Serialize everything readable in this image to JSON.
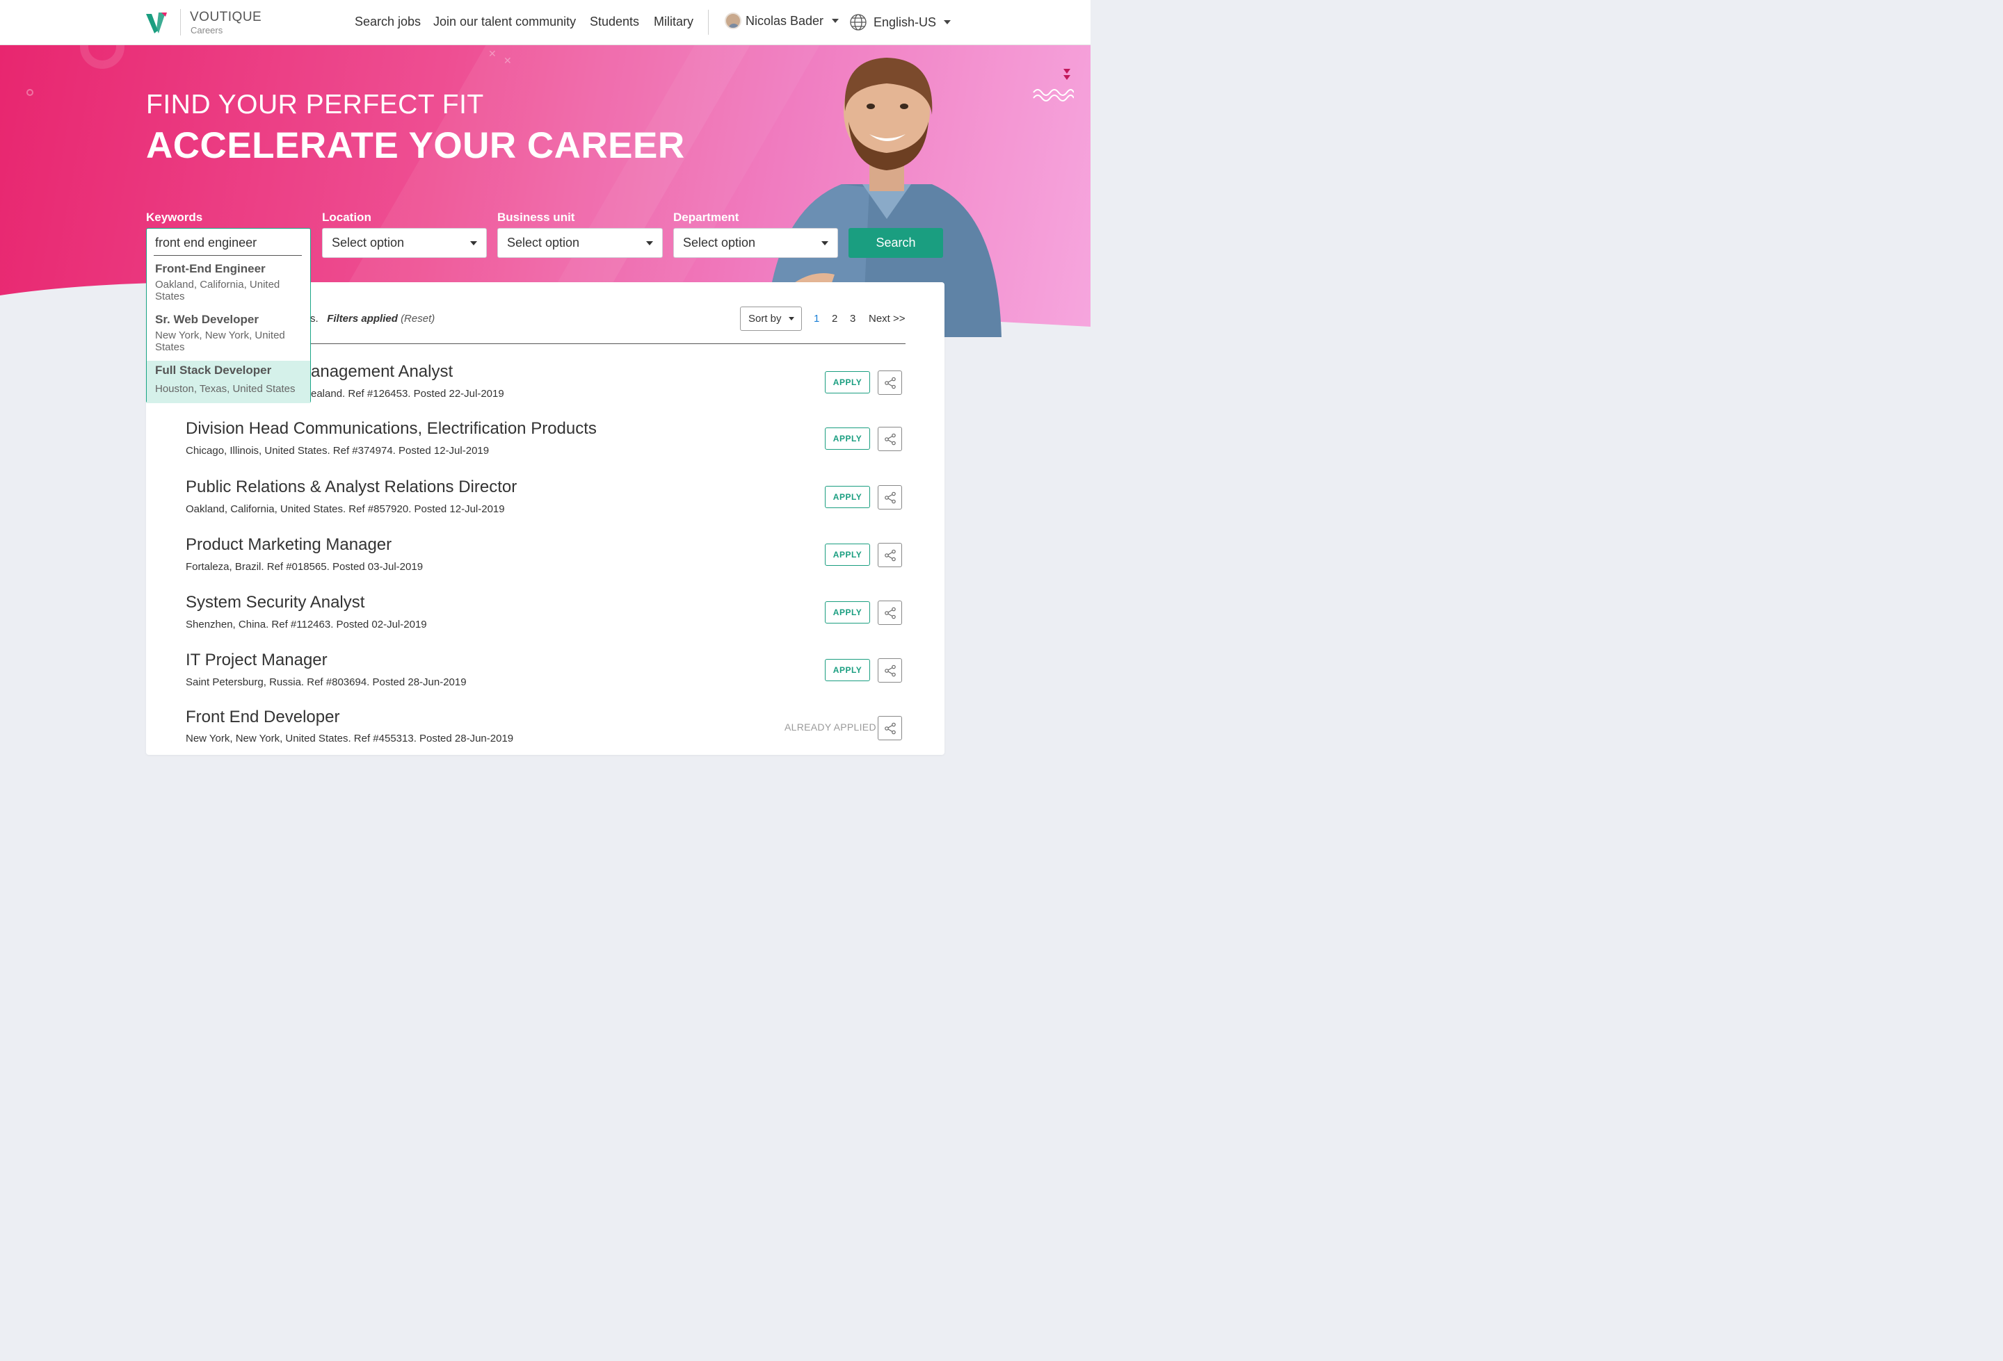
{
  "brand": {
    "name": "VOUTIQUE",
    "sub": "Careers"
  },
  "nav": [
    {
      "label": "Search jobs"
    },
    {
      "label": "Join our talent community"
    },
    {
      "label": "Students"
    },
    {
      "label": "Military"
    }
  ],
  "user": {
    "name": "Nicolas Bader"
  },
  "language": {
    "label": "English-US"
  },
  "hero": {
    "line1": "FIND YOUR PERFECT FIT",
    "line2": "ACCELERATE YOUR CAREER"
  },
  "filters": {
    "keywords": {
      "label": "Keywords",
      "value": "front end engineer"
    },
    "location": {
      "label": "Location",
      "value": "Select option"
    },
    "business_unit": {
      "label": "Business unit",
      "value": "Select option"
    },
    "department": {
      "label": "Department",
      "value": "Select option"
    },
    "search_label": "Search"
  },
  "suggestions": [
    {
      "title": "Front-End Engineer",
      "location": "Oakland, California, United States"
    },
    {
      "title": "Sr. Web Developer",
      "location": "New York, New York, United States"
    },
    {
      "title": "Full Stack Developer",
      "location": "Houston, Texas, United States",
      "active": true
    }
  ],
  "results": {
    "count_suffix": "s.",
    "filters_applied": "Filters applied",
    "reset": "(Reset)",
    "sort_label": "Sort by",
    "pages": [
      "1",
      "2",
      "3"
    ],
    "current_page": "1",
    "next": "Next >>"
  },
  "jobs": [
    {
      "title": "anagement Analyst",
      "meta": "ealand. Ref #126453. Posted 22-Jul-2019",
      "action": "APPLY"
    },
    {
      "title": "Division Head Communications, Electrification Products",
      "meta": "Chicago, Illinois, United States. Ref #374974. Posted 12-Jul-2019",
      "action": "APPLY"
    },
    {
      "title": "Public Relations & Analyst Relations Director",
      "meta": "Oakland, California, United States. Ref #857920. Posted 12-Jul-2019",
      "action": "APPLY"
    },
    {
      "title": "Product Marketing Manager",
      "meta": "Fortaleza, Brazil. Ref #018565. Posted 03-Jul-2019",
      "action": "APPLY"
    },
    {
      "title": "System Security Analyst",
      "meta": "Shenzhen, China. Ref #112463. Posted 02-Jul-2019",
      "action": "APPLY"
    },
    {
      "title": "IT Project Manager",
      "meta": "Saint Petersburg, Russia. Ref #803694. Posted 28-Jun-2019",
      "action": "APPLY"
    },
    {
      "title": "Front End Developer",
      "meta": "New York, New York, United States. Ref #455313. Posted 28-Jun-2019",
      "action": "ALREADY APPLIED"
    }
  ],
  "colors": {
    "accent": "#1a9e80",
    "hero_start": "#e8266f",
    "hero_end": "#f6a6de",
    "link": "#1a7fd6"
  }
}
